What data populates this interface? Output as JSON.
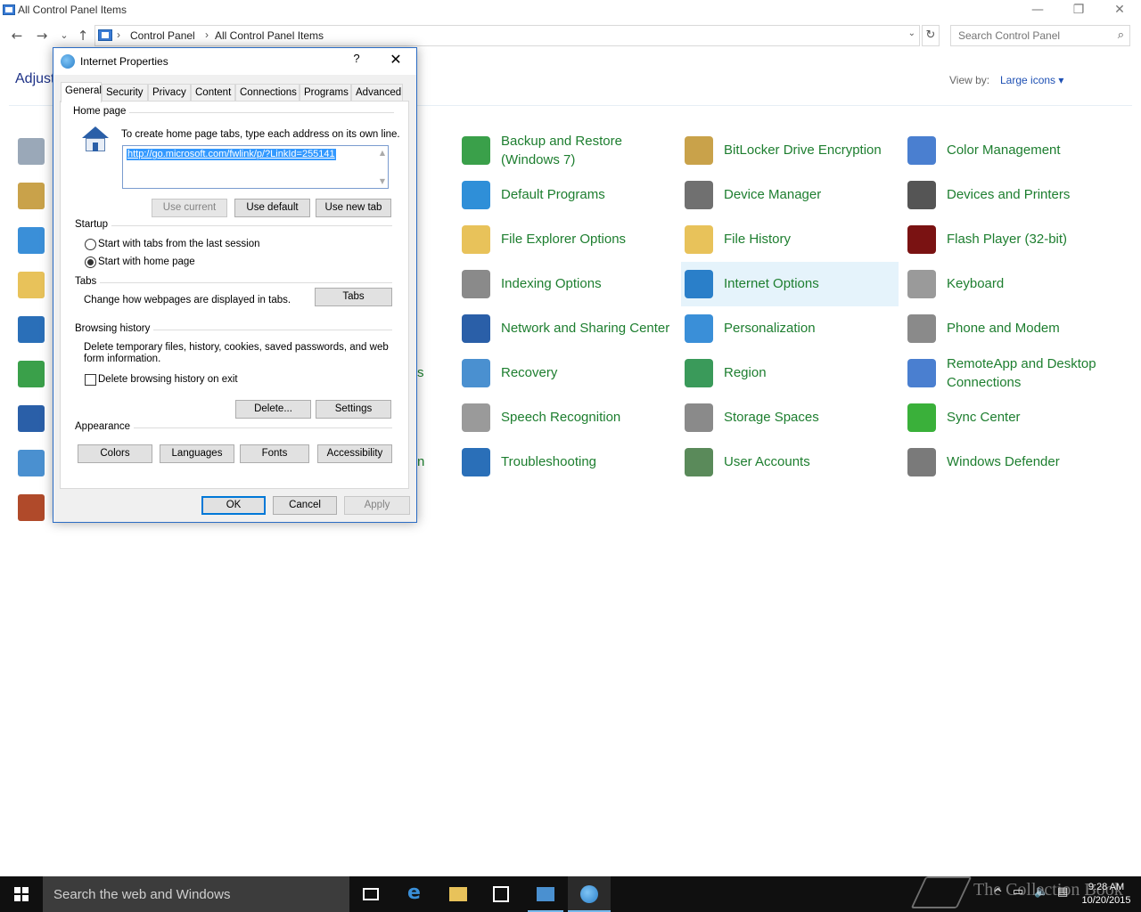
{
  "window": {
    "title": "All Control Panel Items",
    "minimize_glyph": "—",
    "restore_glyph": "❐",
    "close_glyph": "✕"
  },
  "nav": {
    "back_glyph": "←",
    "forward_glyph": "→",
    "recent_glyph": "⌄",
    "up_glyph": "↑",
    "refresh_glyph": "↻"
  },
  "address": {
    "crumbs": [
      "Control Panel",
      "All Control Panel Items"
    ],
    "separator": "›",
    "dropdown_glyph": "⌄"
  },
  "search": {
    "placeholder": "Search Control Panel",
    "icon": "search-icon"
  },
  "header": {
    "heading": "Adjust",
    "viewby_label": "View by:",
    "viewby_value": "Large icons ▾"
  },
  "peek": {
    "left_s": "s",
    "left_n": "n"
  },
  "items": [
    {
      "label": "Backup and Restore (Windows 7)",
      "icon": "backup-icon",
      "color": "#3aa04a"
    },
    {
      "label": "BitLocker Drive Encryption",
      "icon": "key-icon",
      "color": "#c9a24a"
    },
    {
      "label": "Color Management",
      "icon": "color-icon",
      "color": "#4a7fd0"
    },
    {
      "label": "Default Programs",
      "icon": "default-programs-icon",
      "color": "#2f8fd8"
    },
    {
      "label": "Device Manager",
      "icon": "device-manager-icon",
      "color": "#707070"
    },
    {
      "label": "Devices and Printers",
      "icon": "printer-icon",
      "color": "#555555"
    },
    {
      "label": "File Explorer Options",
      "icon": "folder-options-icon",
      "color": "#e8c25a"
    },
    {
      "label": "File History",
      "icon": "file-history-icon",
      "color": "#e8c25a"
    },
    {
      "label": "Flash Player (32-bit)",
      "icon": "flash-icon",
      "color": "#7a1212"
    },
    {
      "label": "Indexing Options",
      "icon": "indexing-icon",
      "color": "#8a8a8a"
    },
    {
      "label": "Internet Options",
      "icon": "internet-options-icon",
      "color": "#2a7fc9"
    },
    {
      "label": "Keyboard",
      "icon": "keyboard-icon",
      "color": "#9a9a9a"
    },
    {
      "label": "Network and Sharing Center",
      "icon": "network-icon",
      "color": "#2a5fa8"
    },
    {
      "label": "Personalization",
      "icon": "personalization-icon",
      "color": "#3a8fd8"
    },
    {
      "label": "Phone and Modem",
      "icon": "phone-icon",
      "color": "#8a8a8a"
    },
    {
      "label": "Recovery",
      "icon": "recovery-icon",
      "color": "#4a90d0"
    },
    {
      "label": "Region",
      "icon": "region-icon",
      "color": "#3a9a5a"
    },
    {
      "label": "RemoteApp and Desktop Connections",
      "icon": "remoteapp-icon",
      "color": "#4a7fd0"
    },
    {
      "label": "Speech Recognition",
      "icon": "microphone-icon",
      "color": "#9a9a9a"
    },
    {
      "label": "Storage Spaces",
      "icon": "storage-icon",
      "color": "#8a8a8a"
    },
    {
      "label": "Sync Center",
      "icon": "sync-icon",
      "color": "#3ab03a"
    },
    {
      "label": "Troubleshooting",
      "icon": "troubleshooting-icon",
      "color": "#2a6fb8"
    },
    {
      "label": "User Accounts",
      "icon": "user-accounts-icon",
      "color": "#5a8a5a"
    },
    {
      "label": "Windows Defender",
      "icon": "defender-icon",
      "color": "#7a7a7a"
    }
  ],
  "dialog": {
    "title": "Internet Properties",
    "help_glyph": "?",
    "close_glyph": "✕",
    "tabs": [
      "General",
      "Security",
      "Privacy",
      "Content",
      "Connections",
      "Programs",
      "Advanced"
    ],
    "active_tab": "General",
    "home_page": {
      "group_label": "Home page",
      "instructions": "To create home page tabs, type each address on its own line.",
      "url": "http://go.microsoft.com/fwlink/p/?LinkId=255141",
      "use_current": "Use current",
      "use_default": "Use default",
      "use_new_tab": "Use new tab"
    },
    "startup": {
      "group_label": "Startup",
      "option_last_session": "Start with tabs from the last session",
      "option_home_page": "Start with home page",
      "selected": "Start with home page"
    },
    "tabs_group": {
      "group_label": "Tabs",
      "description": "Change how webpages are displayed in tabs.",
      "button": "Tabs"
    },
    "browsing_history": {
      "group_label": "Browsing history",
      "description_line1": "Delete temporary files, history, cookies, saved passwords, and web",
      "description_line2": "form information.",
      "checkbox_label": "Delete browsing history on exit",
      "delete_button": "Delete...",
      "settings_button": "Settings"
    },
    "appearance": {
      "group_label": "Appearance",
      "colors": "Colors",
      "languages": "Languages",
      "fonts": "Fonts",
      "accessibility": "Accessibility"
    },
    "ok": "OK",
    "cancel": "Cancel",
    "apply": "Apply"
  },
  "taskbar": {
    "search_placeholder": "Search the web and Windows",
    "time": "9:28 AM",
    "date": "10/20/2015",
    "tray_icons": [
      "^",
      "▭",
      "🔈",
      "▤"
    ]
  },
  "watermark": "The Collection Book"
}
